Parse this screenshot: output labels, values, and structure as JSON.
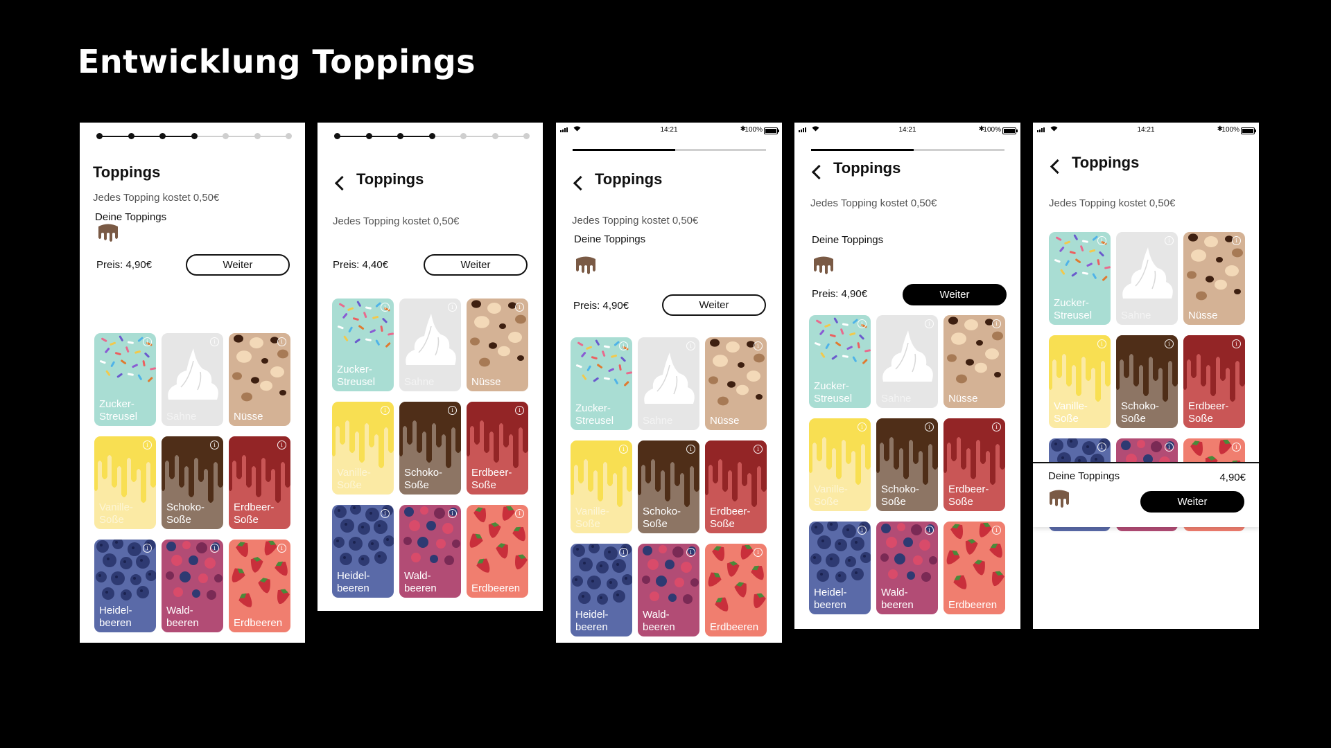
{
  "page": {
    "title": "Entwicklung Toppings"
  },
  "status": {
    "time": "14:21",
    "battery": "100%"
  },
  "screen": {
    "heading": "Toppings",
    "note": "Jedes Topping kostet 0,50€",
    "your_toppings": "Deine Toppings",
    "continue": "Weiter"
  },
  "prices": {
    "f1": "Preis: 4,90€",
    "f2": "Preis: 4,40€",
    "f3": "Preis: 4,90€",
    "f4": "Preis: 4,90€",
    "f5": "4,90€"
  },
  "steppers": {
    "f1_completed_steps": 4,
    "f2_completed_steps": 4,
    "total_steps": 7
  },
  "progress_fraction": {
    "f3": 0.53,
    "f4": 0.53
  },
  "toppings": [
    {
      "id": "zucker",
      "label": "Zucker-\nStreusel",
      "bg": "#a9ddd3",
      "art": "sprinkles"
    },
    {
      "id": "sahne",
      "label": "Sahne",
      "bg": "#e6e6e6",
      "art": "cream"
    },
    {
      "id": "nuesse",
      "label": "Nüsse",
      "bg": "#d4b295",
      "art": "nuts"
    },
    {
      "id": "vanille",
      "label": "Vanille-\nSoße",
      "bg": "#fbeaa4",
      "art": "drip",
      "drip": "#f8df52"
    },
    {
      "id": "schoko",
      "label": "Schoko-\nSoße",
      "bg": "#8d7564",
      "art": "drip",
      "drip": "#4f2e18"
    },
    {
      "id": "erdbeer",
      "label": "Erdbeer-\nSoße",
      "bg": "#c95656",
      "art": "drip",
      "drip": "#932526"
    },
    {
      "id": "heidel",
      "label": "Heidel-\nbeeren",
      "bg": "#5a6aa8",
      "art": "blueberries"
    },
    {
      "id": "wald",
      "label": "Wald-\nbeeren",
      "bg": "#b24c75",
      "art": "forest"
    },
    {
      "id": "erdbeeren",
      "label": "Erdbeeren",
      "bg": "#f07e6f",
      "art": "strawberries"
    }
  ],
  "faded": {
    "f1": [
      "sahne",
      "vanille"
    ],
    "f2": [
      "sahne",
      "vanille"
    ],
    "f3": [
      "sahne",
      "vanille"
    ],
    "f4": [
      "sahne",
      "vanille"
    ],
    "f5": [
      "sahne"
    ]
  },
  "colors": {
    "background": "#000000",
    "selected_icon": "#7a5a45"
  }
}
